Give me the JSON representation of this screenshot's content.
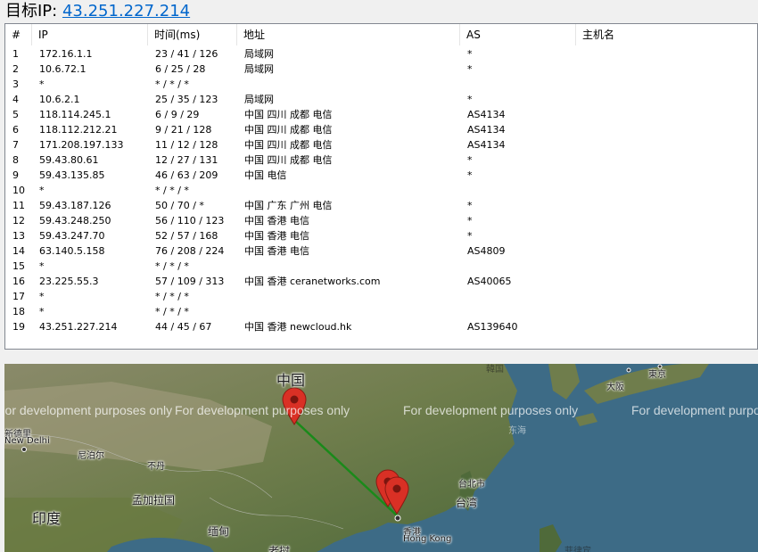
{
  "header": {
    "label": "目标IP:",
    "ip": "43.251.227.214"
  },
  "table": {
    "columns": [
      "#",
      "IP",
      "时间(ms)",
      "地址",
      "AS",
      "主机名"
    ],
    "rows": [
      [
        "1",
        "172.16.1.1",
        "23 / 41 / 126",
        "局域网",
        "*",
        ""
      ],
      [
        "2",
        "10.6.72.1",
        "6 / 25 / 28",
        "局域网",
        "*",
        ""
      ],
      [
        "3",
        "*",
        "* / * / *",
        "",
        "",
        ""
      ],
      [
        "4",
        "10.6.2.1",
        "25 / 35 / 123",
        "局域网",
        "*",
        ""
      ],
      [
        "5",
        "118.114.245.1",
        "6 / 9 / 29",
        "中国 四川 成都 电信",
        "AS4134",
        ""
      ],
      [
        "6",
        "118.112.212.21",
        "9 / 21 / 128",
        "中国 四川 成都 电信",
        "AS4134",
        ""
      ],
      [
        "7",
        "171.208.197.133",
        "11 / 12 / 128",
        "中国 四川 成都 电信",
        "AS4134",
        ""
      ],
      [
        "8",
        "59.43.80.61",
        "12 / 27 / 131",
        "中国 四川 成都 电信",
        "*",
        ""
      ],
      [
        "9",
        "59.43.135.85",
        "46 / 63 / 209",
        "中国 电信",
        "*",
        ""
      ],
      [
        "10",
        "*",
        "* / * / *",
        "",
        "",
        ""
      ],
      [
        "11",
        "59.43.187.126",
        "50 / 70 / *",
        "中国 广东 广州 电信",
        "*",
        ""
      ],
      [
        "12",
        "59.43.248.250",
        "56 / 110 / 123",
        "中国 香港 电信",
        "*",
        ""
      ],
      [
        "13",
        "59.43.247.70",
        "52 / 57 / 168",
        "中国 香港 电信",
        "*",
        ""
      ],
      [
        "14",
        "63.140.5.158",
        "76 / 208 / 224",
        "中国 香港 电信",
        "AS4809",
        ""
      ],
      [
        "15",
        "*",
        "* / * / *",
        "",
        "",
        ""
      ],
      [
        "16",
        "23.225.55.3",
        "57 / 109 / 313",
        "中国 香港 ceranetworks.com",
        "AS40065",
        ""
      ],
      [
        "17",
        "*",
        "* / * / *",
        "",
        "",
        ""
      ],
      [
        "18",
        "*",
        "* / * / *",
        "",
        "",
        ""
      ],
      [
        "19",
        "43.251.227.214",
        "44 / 45 / 67",
        "中国 香港 newcloud.hk",
        "AS139640",
        ""
      ]
    ]
  },
  "map": {
    "watermarks": [
      "For development purposes only",
      "For development purposes only",
      "For development purposes only",
      "For development purposes only"
    ],
    "labels": {
      "china": "中国",
      "new_delhi_cn": "新德里",
      "new_delhi_en": "New Delhi",
      "nepal": "尼泊尔",
      "bhutan": "不丹",
      "bangladesh": "孟加拉国",
      "india": "印度",
      "myanmar": "缅甸",
      "laos": "老挝",
      "taipei": "台北市",
      "taiwan": "台湾",
      "hongkong_cn": "香港",
      "hongkong_en": "Hong Kong",
      "east_sea": "东海",
      "osaka": "大阪",
      "tokyo": "東京",
      "korea": "韓国",
      "philippines": "菲律宾"
    },
    "colors": {
      "route_line": "#1a8a1a",
      "marker": "#d93025",
      "sea": "#3d6b86",
      "land": "#6b7a4a"
    },
    "icons": [
      "map-marker-icon",
      "city-dot-icon"
    ]
  }
}
